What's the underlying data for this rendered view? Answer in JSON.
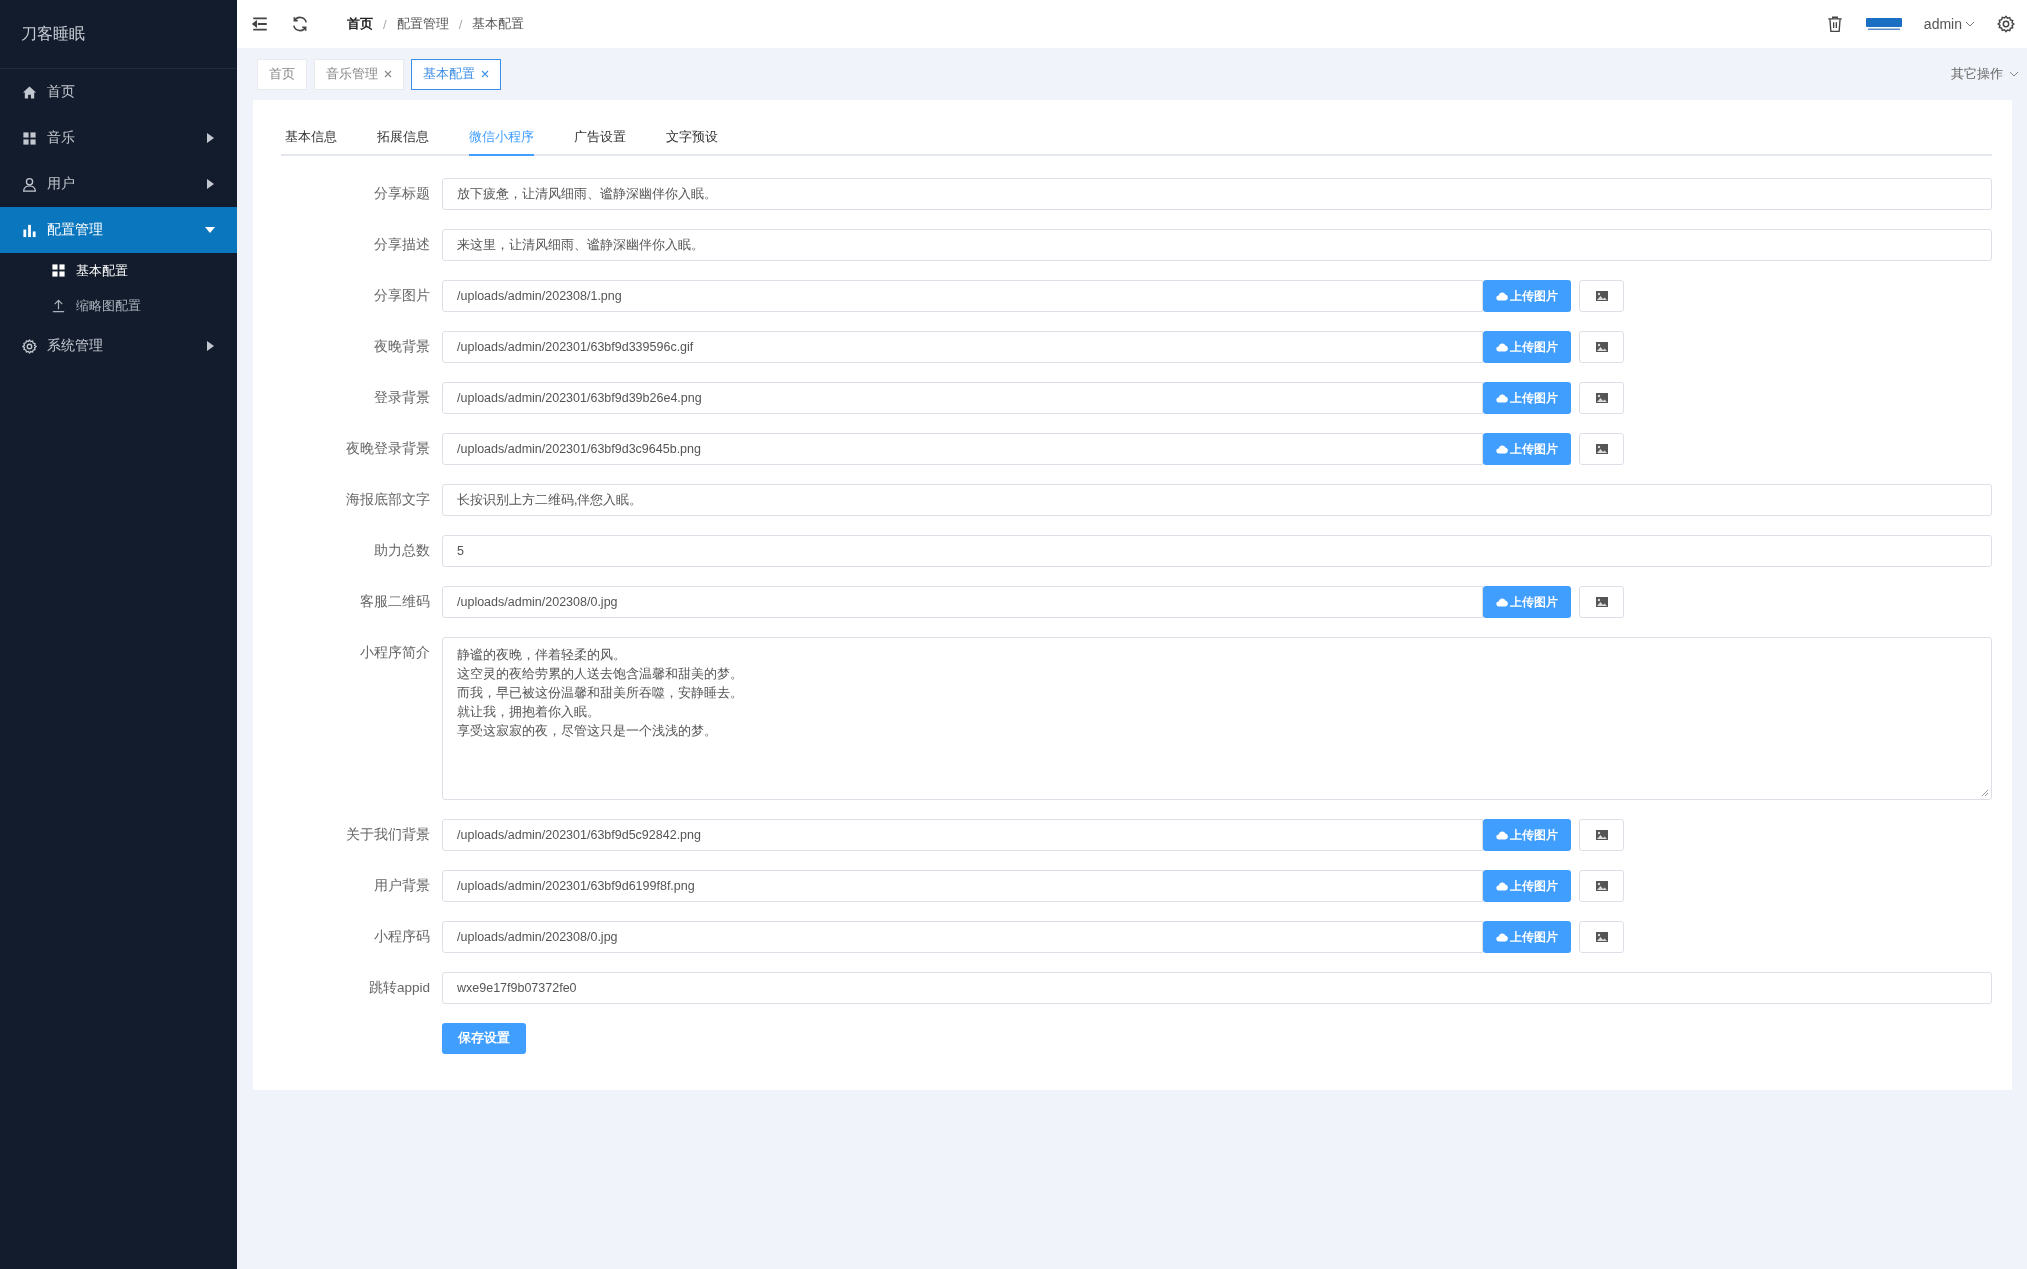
{
  "sidebar": {
    "brand": "刀客睡眠",
    "items": [
      {
        "label": "首页",
        "selected": false
      },
      {
        "label": "音乐",
        "selected": false,
        "expanded": false
      },
      {
        "label": "用户",
        "selected": false,
        "expanded": false
      },
      {
        "label": "配置管理",
        "selected": true,
        "expanded": true,
        "children": [
          {
            "label": "基本配置",
            "selected": true
          },
          {
            "label": "缩略图配置",
            "selected": false
          }
        ]
      },
      {
        "label": "系统管理",
        "selected": false,
        "expanded": false
      }
    ]
  },
  "header": {
    "breadcrumb": [
      "首页",
      "配置管理",
      "基本配置"
    ],
    "separator": "/",
    "user": "admin"
  },
  "page_tabs": {
    "tabs": [
      {
        "label": "首页",
        "closable": false,
        "selected": false
      },
      {
        "label": "音乐管理",
        "closable": true,
        "selected": false
      },
      {
        "label": "基本配置",
        "closable": true,
        "selected": true
      }
    ],
    "more": "其它操作"
  },
  "form_tabs": [
    {
      "label": "基本信息",
      "selected": false
    },
    {
      "label": "拓展信息",
      "selected": false
    },
    {
      "label": "微信小程序",
      "selected": true
    },
    {
      "label": "广告设置",
      "selected": false
    },
    {
      "label": "文字预设",
      "selected": false
    }
  ],
  "fields": [
    {
      "kind": "text",
      "label": "分享标题",
      "value": "放下疲惫，让清风细雨、谧静深幽伴你入眠。"
    },
    {
      "kind": "text",
      "label": "分享描述",
      "value": "来这里，让清风细雨、谧静深幽伴你入眠。"
    },
    {
      "kind": "upload",
      "label": "分享图片",
      "value": "/uploads/admin/202308/1.png",
      "button": "上传图片"
    },
    {
      "kind": "upload",
      "label": "夜晚背景",
      "value": "/uploads/admin/202301/63bf9d339596c.gif",
      "button": "上传图片"
    },
    {
      "kind": "upload",
      "label": "登录背景",
      "value": "/uploads/admin/202301/63bf9d39b26e4.png",
      "button": "上传图片"
    },
    {
      "kind": "upload",
      "label": "夜晚登录背景",
      "value": "/uploads/admin/202301/63bf9d3c9645b.png",
      "button": "上传图片"
    },
    {
      "kind": "text",
      "label": "海报底部文字",
      "value": "长按识别上方二维码,伴您入眠。"
    },
    {
      "kind": "text",
      "label": "助力总数",
      "value": "5"
    },
    {
      "kind": "upload",
      "label": "客服二维码",
      "value": "/uploads/admin/202308/0.jpg",
      "button": "上传图片"
    },
    {
      "kind": "textarea",
      "label": "小程序简介",
      "lines": [
        "静谧的夜晚，伴着轻柔的风。",
        "这空灵的夜给劳累的人送去饱含温馨和甜美的梦。",
        "而我，早已被这份温馨和甜美所吞噬，安静睡去。",
        "就让我，拥抱着你入眠。",
        "享受这寂寂的夜，尽管这只是一个浅浅的梦。"
      ]
    },
    {
      "kind": "upload",
      "label": "关于我们背景",
      "value": "/uploads/admin/202301/63bf9d5c92842.png",
      "button": "上传图片"
    },
    {
      "kind": "upload",
      "label": "用户背景",
      "value": "/uploads/admin/202301/63bf9d6199f8f.png",
      "button": "上传图片"
    },
    {
      "kind": "upload",
      "label": "小程序码",
      "value": "/uploads/admin/202308/0.jpg",
      "button": "上传图片"
    },
    {
      "kind": "text",
      "label": "跳转appid",
      "value": "wxe9e17f9b07372fe0"
    }
  ],
  "save_button": "保存设置"
}
